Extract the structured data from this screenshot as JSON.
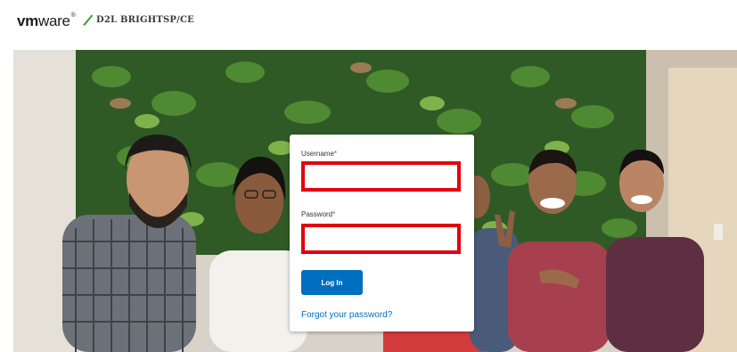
{
  "header": {
    "vmware_logo": {
      "strong": "vm",
      "light": "ware",
      "mark": "®"
    },
    "d2l_logo": "D2L BRIGHTSP∕CE"
  },
  "hero": {
    "image": "group-photo-plant-wall"
  },
  "login": {
    "username_label": "Username",
    "password_label": "Password",
    "required_mark": "*",
    "username_value": "",
    "password_value": "",
    "login_button": "Log In",
    "forgot_link": "Forgot your password?"
  },
  "colors": {
    "accent": "#006fbf",
    "highlight": "#e3000f"
  }
}
